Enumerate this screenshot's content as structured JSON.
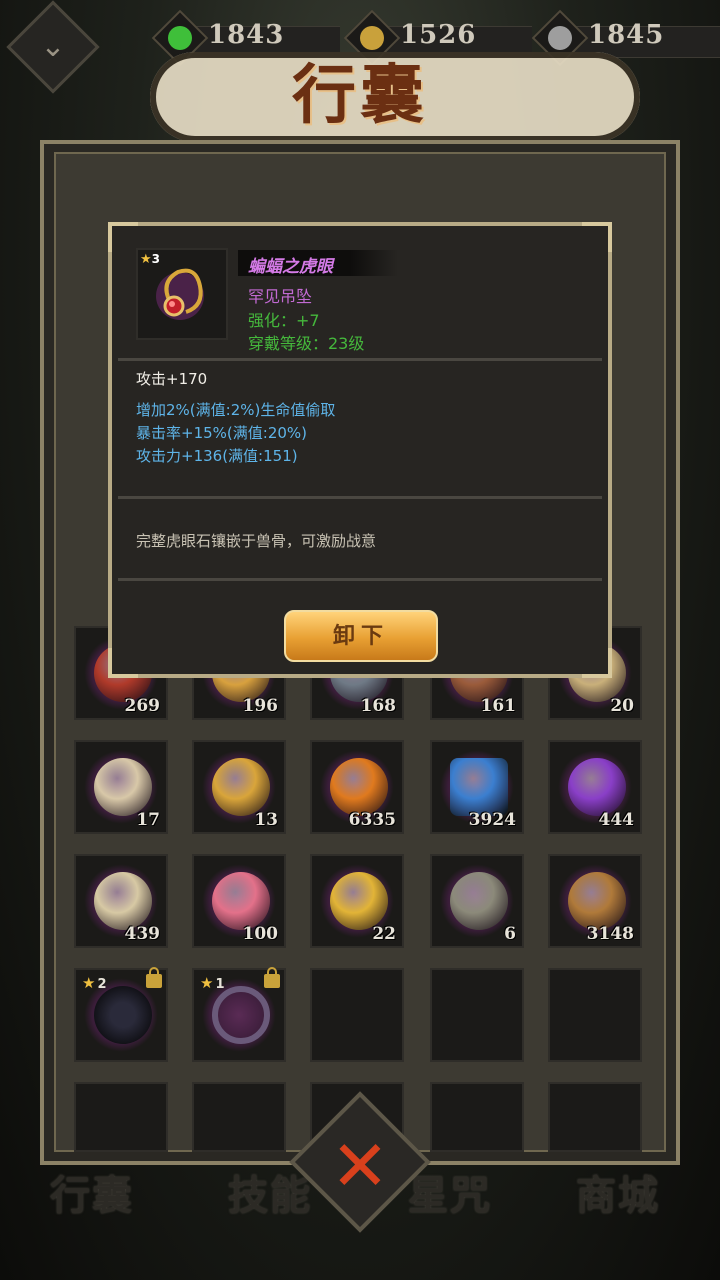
{
  "title": "行囊",
  "currencies": [
    {
      "name": "jade-currency",
      "value": "1843",
      "color": "#3fbf3a"
    },
    {
      "name": "coin-currency",
      "value": "1526",
      "color": "#c9a13b"
    },
    {
      "name": "spirit-currency",
      "value": "1845",
      "color": "#9e9e9e"
    }
  ],
  "popup": {
    "item_stars": "3",
    "item_name": "蝙蝠之虎眼",
    "rarity": "罕见吊坠",
    "enhance": "强化：+7",
    "wear_level": "穿戴等级：23级",
    "main_stat": "攻击+170",
    "sub_stats": [
      "增加2%(满值:2%)生命值偷取",
      "暴击率+15%(满值:20%)",
      "攻击力+136(满值:151)"
    ],
    "description": "完整虎眼石镶嵌于兽骨，可激励战意",
    "unequip_label": "卸下"
  },
  "inventory": {
    "row1": [
      "269",
      "196",
      "168",
      "161",
      "20"
    ],
    "row2": [
      "17",
      "13",
      "6335",
      "3924",
      "444"
    ],
    "row3": [
      "439",
      "100",
      "22",
      "6",
      "3148"
    ],
    "row4": [
      {
        "stars": "2",
        "locked": true
      },
      {
        "stars": "1",
        "locked": true
      }
    ]
  },
  "nav": {
    "tab1": "行囊",
    "tab2": "技能",
    "tab3": "星咒",
    "tab4": "商城"
  },
  "colors": {
    "rarity_purple": "#c26ad3",
    "stat_green": "#45b83c",
    "substat_blue": "#5eb4e8",
    "close_red": "#d8401c"
  }
}
